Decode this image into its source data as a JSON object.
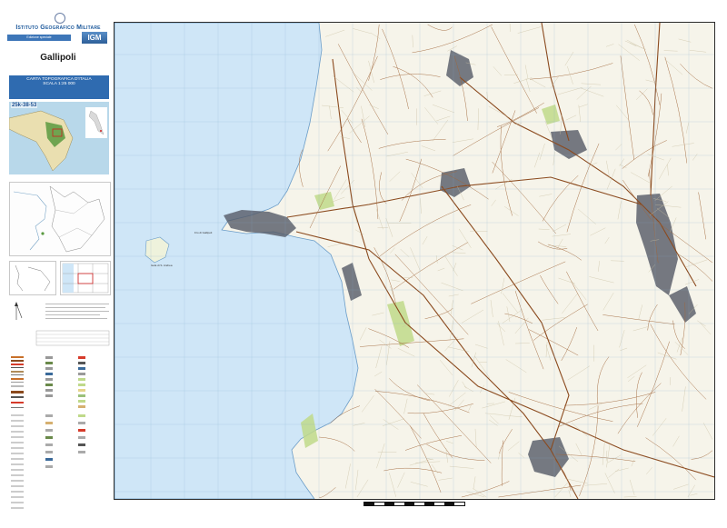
{
  "header": {
    "institute": "Istituto Geografico Militare",
    "edition": "Edizione speciale",
    "igm_badge": "IGM"
  },
  "sheet": {
    "name": "Gallipoli",
    "title_line1": "CARTA TOPOGRAFICA D'ITALIA",
    "title_line2": "SCALA 1:25 000",
    "code": "25k-38-53"
  },
  "map": {
    "sea_color": "#cfe6f7",
    "land_color": "#f6f4ea",
    "road_color": "#8b4a1e",
    "urban_color": "#555a66",
    "vegetation_color": "#bfd98a",
    "labels": {
      "island": "Isola di S. Andrea",
      "lighthouse": "F.lo di Gallipoli"
    }
  },
  "icons": [
    "emblem-icon",
    "qr-code-icon",
    "north-arrow-icon"
  ]
}
